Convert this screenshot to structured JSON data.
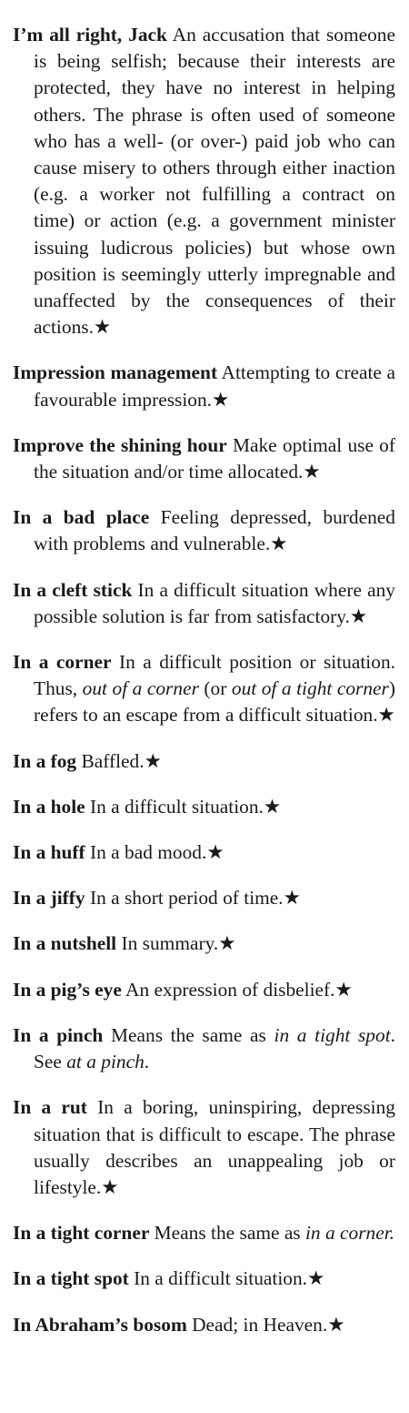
{
  "entries": [
    {
      "term": "I’m all right, Jack",
      "def": " An accusation that someone is being selfish; because their interests are protected, they have no interest in helping others. The phrase is often used of someone who has a well- (or over-) paid job who can cause misery to others through either inaction (e.g. a worker not fulfilling a contract on time) or action (e.g. a government minister issuing ludicrous policies) but whose own position is seemingly utterly impregnable and unaffected by the con­sequences of their actions.★"
    },
    {
      "term": "Impression management",
      "def": " Attempting to create a favourable impression.★"
    },
    {
      "term": "Improve the shining hour",
      "def": " Make optimal use of the situation and/or time allo­cated.★"
    },
    {
      "term": "In a bad place",
      "def": " Feeling depressed, bur­dened with problems and vulnerable.★"
    },
    {
      "term": "In a cleft stick",
      "def": " In a difficult situation where any possible solution is far from satisfactory.★"
    },
    {
      "term": "In a corner",
      "def1": " In a difficult position or situ­ation. Thus, ",
      "ital1": "out of a corner",
      "def2": " (or ",
      "ital2": "out of a tight corner",
      "def3": ") refers to an escape from a difficult situation.★"
    },
    {
      "term": "In a fog",
      "def": " Baffled.★"
    },
    {
      "term": "In a hole",
      "def": " In a difficult situation.★"
    },
    {
      "term": "In a huff",
      "def": " In a bad mood.★"
    },
    {
      "term": "In a jiffy",
      "def": " In a short period of time.★"
    },
    {
      "term": "In a nutshell",
      "def": " In summary.★"
    },
    {
      "term": "In a pig’s eye",
      "def": " An expression of disbelief.★"
    },
    {
      "term": "In a pinch",
      "def1": " Means the same as ",
      "ital1": "in a tight spot",
      "def2": ". See ",
      "ital2": "at a pinch",
      "def3": "."
    },
    {
      "term": "In a rut",
      "def": " In a boring, uninspiring, depress­ing situation that is difficult to escape. The phrase usually describes an unap­pealing job or lifestyle.★"
    },
    {
      "term": "In a tight corner",
      "def1": " Means the same as ",
      "ital1": "in a corner.",
      "def2": ""
    },
    {
      "term": "In a tight spot",
      "def": " In a difficult situation.★"
    },
    {
      "term": "In Abraham’s bosom",
      "def": " Dead; in Heaven.★"
    }
  ]
}
